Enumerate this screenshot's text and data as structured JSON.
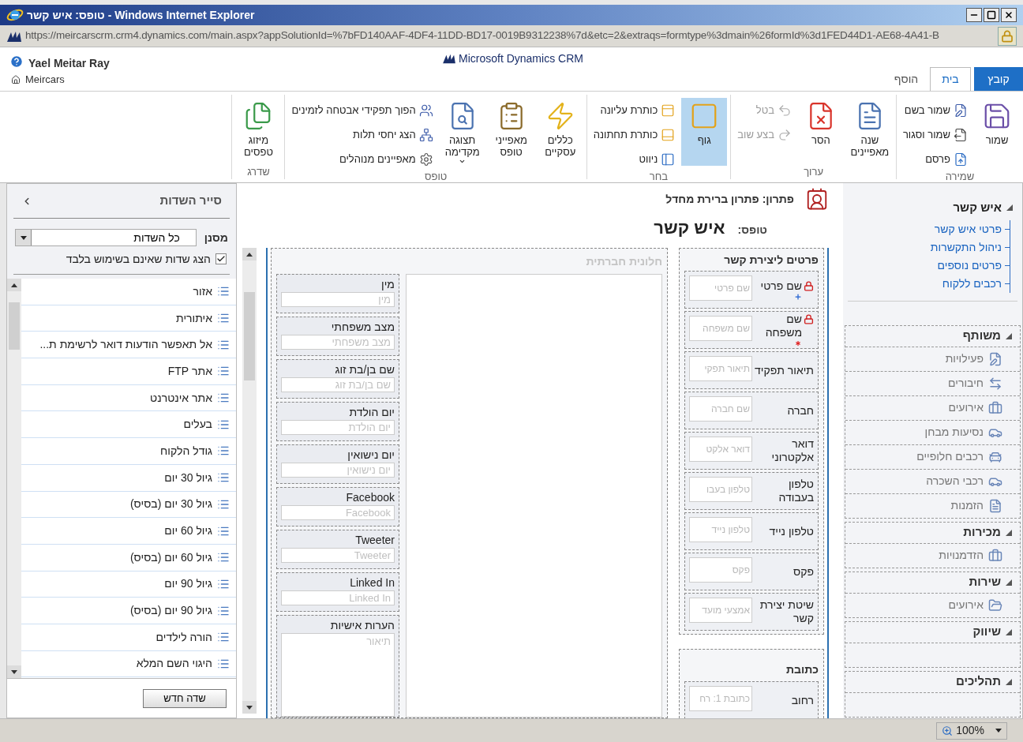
{
  "window": {
    "title": "טופס: איש קשר - Windows Internet Explorer"
  },
  "address_bar": {
    "url": "https://meircarscrm.crm4.dynamics.com/main.aspx?appSolutionId=%7bFD140AAF-4DF4-11DD-BD17-0019B9312238%7d&etc=2&extraqs=formtype%3dmain%26formId%3d1FED44D1-AE68-4A41-B"
  },
  "header": {
    "user": "Yael Meitar Ray",
    "organization": "Meircars",
    "product": "Microsoft Dynamics CRM"
  },
  "tabs": [
    {
      "label": "קובץ",
      "kind": "application",
      "selected": false
    },
    {
      "label": "בית",
      "kind": "tab",
      "selected": true
    },
    {
      "label": "הוסף",
      "kind": "tab",
      "selected": false
    }
  ],
  "ribbon": {
    "groups": [
      {
        "label": "שמירה",
        "buttons": [
          {
            "kind": "large",
            "label": "שמור"
          },
          {
            "kind": "small",
            "label": "שמור בשם"
          },
          {
            "kind": "small",
            "label": "שמור וסגור"
          },
          {
            "kind": "small",
            "label": "פרסם"
          }
        ]
      },
      {
        "label": "ערוך",
        "buttons": [
          {
            "kind": "large",
            "label": "שנה מאפיינים",
            "disabled": false
          },
          {
            "kind": "large",
            "label": "הסר",
            "disabled": false
          },
          {
            "kind": "small",
            "label": "בטל",
            "disabled": true
          },
          {
            "kind": "small",
            "label": "בצע שוב",
            "disabled": true
          }
        ]
      },
      {
        "label": "בחר",
        "buttons": [
          {
            "kind": "large",
            "label": "גוף",
            "selected": true
          },
          {
            "kind": "small",
            "label": "כותרת עליונה",
            "selected": false
          },
          {
            "kind": "small",
            "label": "כותרת תחתונה",
            "selected": false
          },
          {
            "kind": "small",
            "label": "ניווט",
            "selected": false
          }
        ]
      },
      {
        "label": "טופס",
        "buttons": [
          {
            "kind": "large",
            "label": "כללים עסקיים"
          },
          {
            "kind": "large",
            "label": "מאפייני טופס"
          },
          {
            "kind": "large",
            "label": "תצוגה מקדימה",
            "has_menu": true
          },
          {
            "kind": "small",
            "label": "הפוך תפקידי אבטחה לזמינים"
          },
          {
            "kind": "small",
            "label": "הצג יחסי תלות"
          },
          {
            "kind": "small",
            "label": "מאפיינים מנוהלים"
          }
        ]
      },
      {
        "label": "שדרג",
        "buttons": [
          {
            "kind": "large",
            "label": "מיזוג טפסים"
          }
        ]
      }
    ]
  },
  "field_explorer": {
    "title": "סייר השדות",
    "filter_label": "מסנן",
    "filter_value": "כל השדות",
    "unused_only": {
      "label": "הצג שדות שאינם בשימוש בלבד",
      "checked": true
    },
    "fields": [
      "אזור",
      "איתורית",
      "אל תאפשר הודעות דואר לרשימת ת...",
      "אתר FTP",
      "אתר אינטרנט",
      "בעלים",
      "גודל הלקוח",
      "גיול 30 יום",
      "גיול 30 יום (בסיס)",
      "גיול 60 יום",
      "גיול 60 יום (בסיס)",
      "גיול 90 יום",
      "גיול 90 יום (בסיס)",
      "הורה לילדים",
      "היגוי השם המלא"
    ],
    "new_field_button": "שדה חדש"
  },
  "form": {
    "solution": "פתרון: פתרון ברירת מחדל",
    "form_label": "טופס:",
    "form_name": "איש קשר",
    "contact_section": {
      "title": "פרטים ליצירת קשר",
      "fields": [
        {
          "label": "שם פרטי",
          "placeholder": "שם פרטי",
          "locked": true,
          "required": false,
          "recommended": true
        },
        {
          "label": "שם משפחה",
          "placeholder": "שם משפחה",
          "locked": true,
          "required": true,
          "recommended": false
        },
        {
          "label": "תיאור תפקיד",
          "placeholder": "תיאור תפקי",
          "locked": false,
          "required": false,
          "recommended": false
        },
        {
          "label": "חברה",
          "placeholder": "שם חברה",
          "locked": false,
          "required": false,
          "recommended": false
        },
        {
          "label": "דואר אלקטרוני",
          "placeholder": "דואר אלקט",
          "locked": false,
          "required": false,
          "recommended": false
        },
        {
          "label": "טלפון בעבודה",
          "placeholder": "טלפון בעבו",
          "locked": false,
          "required": false,
          "recommended": false
        },
        {
          "label": "טלפון נייד",
          "placeholder": "טלפון נייד",
          "locked": false,
          "required": false,
          "recommended": false
        },
        {
          "label": "פקס",
          "placeholder": "פקס",
          "locked": false,
          "required": false,
          "recommended": false
        },
        {
          "label": "שיטת יצירת קשר",
          "placeholder": "אמצעי מועד",
          "locked": false,
          "required": false,
          "recommended": false
        }
      ]
    },
    "address_section": {
      "title": "כתובת",
      "fields": [
        {
          "label": "רחוב",
          "placeholder": "כתובת 1: רח",
          "locked": false,
          "required": false,
          "recommended": false
        }
      ]
    },
    "social_section": {
      "title": "חלונית חברתית",
      "fields": [
        {
          "label": "מין",
          "placeholder": "מין",
          "kind": "text"
        },
        {
          "label": "מצב משפחתי",
          "placeholder": "מצב משפחתי",
          "kind": "text"
        },
        {
          "label": "שם בן/בת זוג",
          "placeholder": "שם בן/בת זוג",
          "kind": "text"
        },
        {
          "label": "יום הולדת",
          "placeholder": "יום הולדת",
          "kind": "text"
        },
        {
          "label": "יום נישואין",
          "placeholder": "יום נישואין",
          "kind": "text"
        },
        {
          "label": "Facebook",
          "placeholder": "Facebook",
          "kind": "text"
        },
        {
          "label": "Tweeter",
          "placeholder": "Tweeter",
          "kind": "text"
        },
        {
          "label": "Linked In",
          "placeholder": "Linked In",
          "kind": "text"
        },
        {
          "label": "הערות אישיות",
          "placeholder": "תיאור",
          "kind": "multiline"
        }
      ]
    }
  },
  "navigation": {
    "entity": {
      "label": "איש קשר",
      "expanded": true,
      "links": [
        "פרטי איש קשר",
        "ניהול התקשרות",
        "פרטים נוספים",
        "רכבים ללקוח"
      ]
    },
    "groups": [
      {
        "label": "משותף",
        "expanded": true,
        "items": [
          "פעילויות",
          "חיבורים",
          "אירועים",
          "נסיעות מבחן",
          "רכבים חלופיים",
          "רכבי השכרה",
          "הזמנות"
        ]
      },
      {
        "label": "מכירות",
        "expanded": true,
        "items": [
          "הזדמנויות"
        ]
      },
      {
        "label": "שירות",
        "expanded": true,
        "items": [
          "אירועים"
        ]
      },
      {
        "label": "שיווק",
        "expanded": true
      },
      {
        "label": "תהליכים",
        "expanded": true
      }
    ]
  },
  "status_bar": {
    "zoom": "100%"
  }
}
